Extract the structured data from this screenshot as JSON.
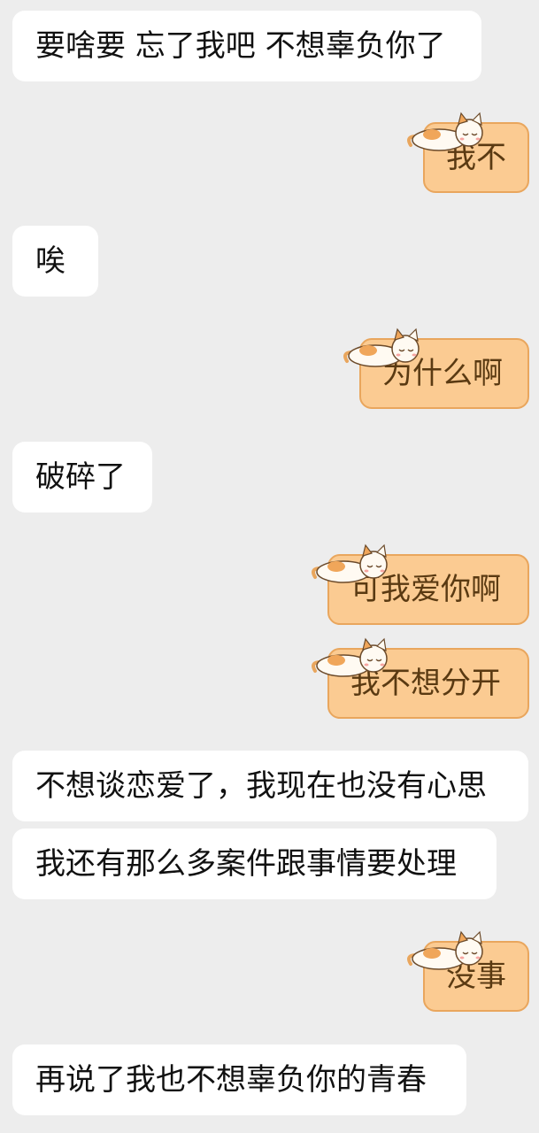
{
  "messages": [
    {
      "side": "in",
      "text": "要啥要 忘了我吧 不想辜负你了"
    },
    {
      "side": "out",
      "text": "我不"
    },
    {
      "side": "in",
      "text": "唉"
    },
    {
      "side": "out",
      "text": "为什么啊"
    },
    {
      "side": "in",
      "text": "破碎了"
    },
    {
      "side": "out",
      "text": "可我爱你啊"
    },
    {
      "side": "out",
      "text": "我不想分开"
    },
    {
      "side": "in",
      "text": "不想谈恋爱了，我现在也没有心思"
    },
    {
      "side": "in",
      "text": "我还有那么多案件跟事情要处理"
    },
    {
      "side": "out",
      "text": "没事"
    },
    {
      "side": "in",
      "text": "再说了我也不想辜负你的青春"
    }
  ],
  "theme": {
    "background": "#ededed",
    "incoming_bubble": "#ffffff",
    "outgoing_bubble": "#fbcb92",
    "outgoing_border": "#e9a65d"
  },
  "decoration": {
    "outgoing_bubble_sticker": "sleeping-cat-icon"
  }
}
